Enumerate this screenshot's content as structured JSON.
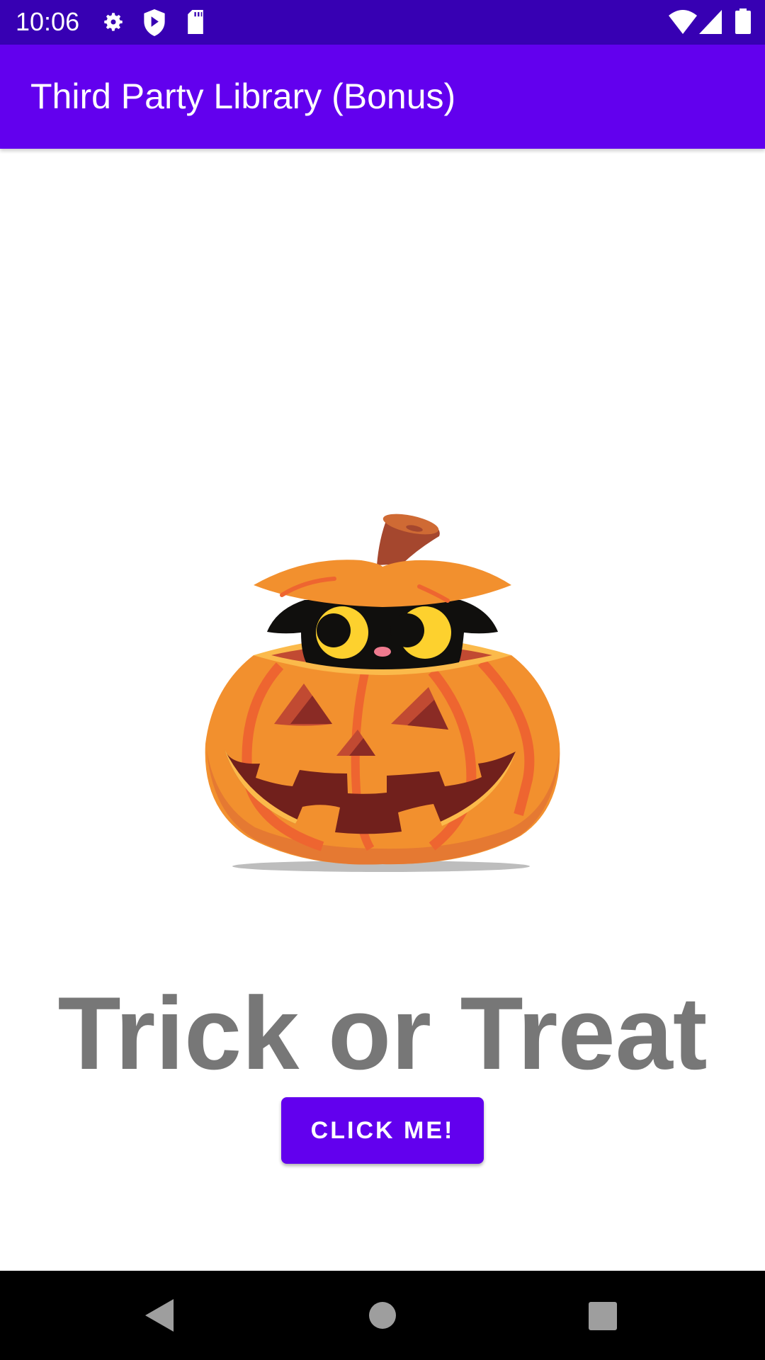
{
  "status_bar": {
    "time": "10:06",
    "icons": [
      "settings-icon",
      "play-protect-icon",
      "sd-card-icon",
      "wifi-icon",
      "signal-icon",
      "battery-icon"
    ],
    "color": "#3700B3"
  },
  "app_bar": {
    "title": "Third Party Library (Bonus)",
    "color": "#6200EE"
  },
  "main": {
    "image": "pumpkin-with-black-cat",
    "headline": "Trick or Treat",
    "button_label": "CLICK ME!"
  },
  "nav_bar": {
    "icons": [
      "back-icon",
      "home-icon",
      "recents-icon"
    ]
  }
}
